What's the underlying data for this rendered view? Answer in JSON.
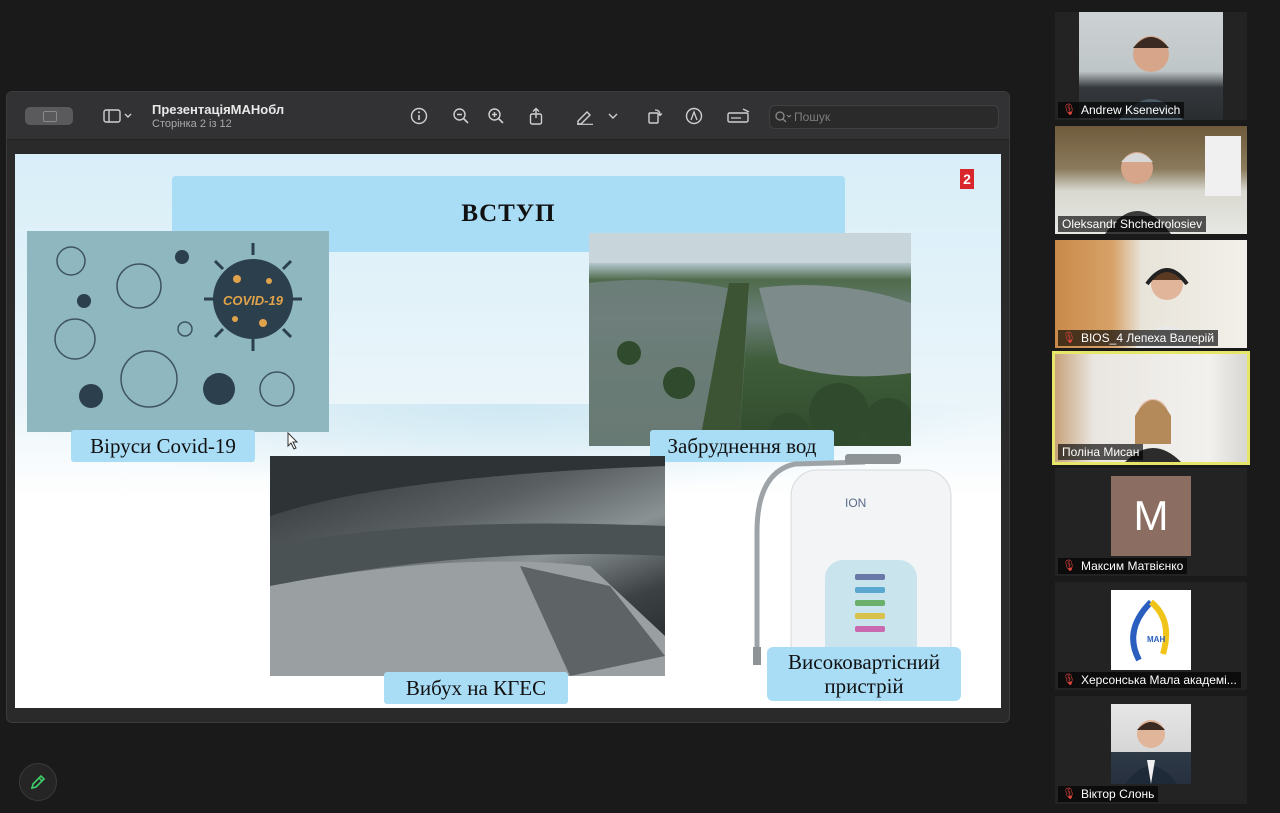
{
  "viewer": {
    "title": "ПрезентаціяМАНобл",
    "subtitle": "Сторінка 2 із 12",
    "search_placeholder": "Пошук"
  },
  "slide": {
    "heading": "ВСТУП",
    "page_number": "2",
    "captions": {
      "covid": "Віруси Covid-19",
      "water": "Забруднення вод",
      "dam": "Вибух на КГЕС",
      "device_line1": "Високовартісний",
      "device_line2": "пристрій"
    },
    "covid_logo_text": "COVID-19"
  },
  "participants": [
    {
      "name": "Andrew Ksenevich",
      "muted": true
    },
    {
      "name": "Oleksandr Shchedrolosiev",
      "muted": false
    },
    {
      "name": "BIOS_4 Лепеха Валерій",
      "muted": true
    },
    {
      "name": "Поліна Мисан",
      "muted": false,
      "active": true
    },
    {
      "name": "Максим Матвієнко",
      "muted": true,
      "initial": "M"
    },
    {
      "name": "Херсонська Мала академі...",
      "muted": true
    },
    {
      "name": "Віктор Слонь",
      "muted": true
    }
  ],
  "colors": {
    "accent_caption": "#a9dcf5",
    "active_speaker": "#e6e66a",
    "mic_off": "#e0453d"
  }
}
